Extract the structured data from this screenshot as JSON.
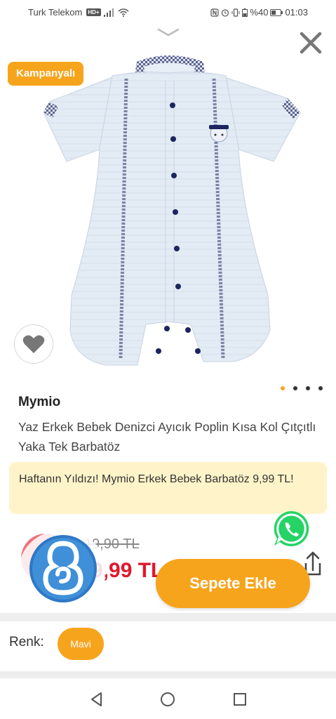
{
  "status_bar": {
    "carrier": "Turk Telekom",
    "network_badge": "HD+",
    "battery": "%40",
    "time": "01:03"
  },
  "product": {
    "campaign_badge": "Kampanyalı",
    "brand": "Mymio",
    "name": "Yaz Erkek Bebek Denizci Ayıcık Poplin Kısa Kol Çıtçıtlı Yaka Tek Barbatöz",
    "promo_text": "Haftanın Yıldızı! Mymio Erkek Bebek Barbatöz 9,99 TL!",
    "old_price": "19,90 TL",
    "new_price": "9,99 TL",
    "image_count": 4,
    "active_image_index": 0
  },
  "actions": {
    "add_to_cart_label": "Sepete Ekle"
  },
  "options": {
    "color_label": "Renk:",
    "selected_color": "Mavi"
  },
  "colors": {
    "accent": "#f7a41d",
    "price_red": "#e0182d",
    "promo_bg": "#fff4c9",
    "whatsapp": "#25d366"
  },
  "icons": {
    "close": "close-icon",
    "chevron": "chevron-down-icon",
    "favorite": "heart-icon",
    "whatsapp": "whatsapp-icon",
    "share": "share-icon",
    "back": "back-triangle-icon",
    "home": "home-circle-icon",
    "recents": "recents-square-icon"
  }
}
